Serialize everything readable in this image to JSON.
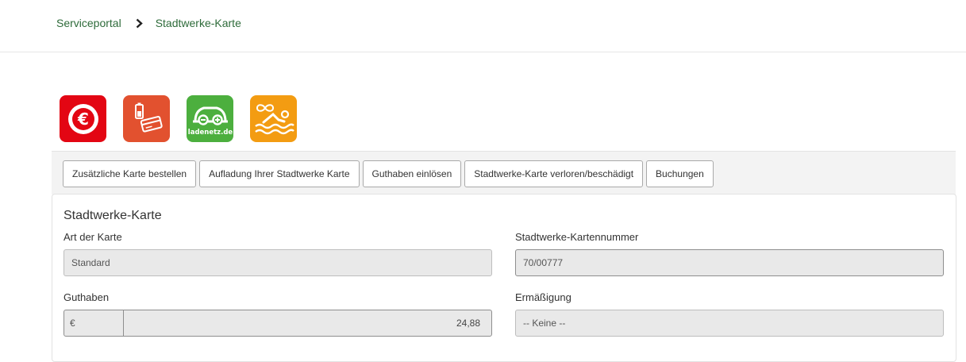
{
  "breadcrumb": {
    "root": "Serviceportal",
    "current": "Stadtwerke-Karte"
  },
  "tiles": [
    {
      "icon": "euro-icon",
      "color": "#e30613"
    },
    {
      "icon": "battery-card-icon",
      "color": "#e2512f"
    },
    {
      "icon": "ladenetz-car-icon",
      "color": "#4caf3e",
      "text": "ladenetz.de"
    },
    {
      "icon": "swimming-icon",
      "color": "#f39c12"
    }
  ],
  "tabs": [
    "Zusätzliche Karte bestellen",
    "Aufladung Ihrer Stadtwerke Karte",
    "Guthaben einlösen",
    "Stadtwerke-Karte verloren/beschädigt",
    "Buchungen"
  ],
  "card": {
    "title": "Stadtwerke-Karte",
    "art_label": "Art der Karte",
    "art_value": "Standard",
    "number_label": "Stadtwerke-Kartennummer",
    "number_value": "70/00777",
    "balance_label": "Guthaben",
    "balance_currency": "€",
    "balance_value": "24,88",
    "discount_label": "Ermäßigung",
    "discount_value": "-- Keine --"
  },
  "colors": {
    "link_green": "#2e6b3a"
  }
}
